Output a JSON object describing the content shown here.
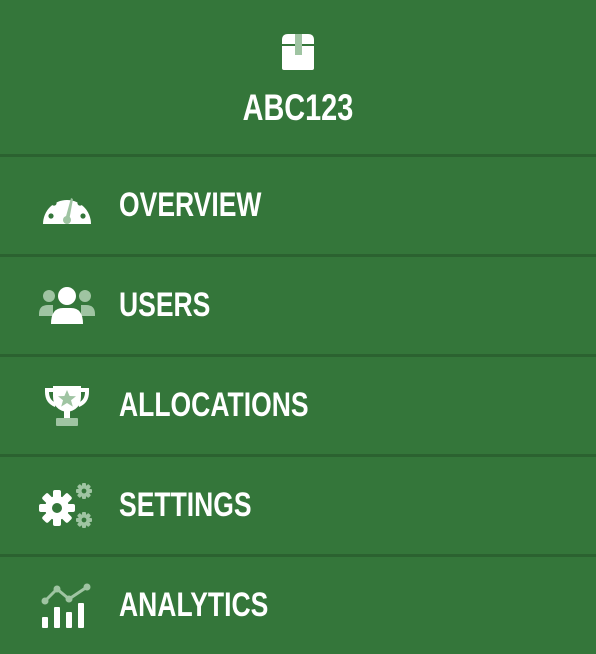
{
  "brand": {
    "title": "ABC123",
    "icon": "box-icon"
  },
  "menu": {
    "items": [
      {
        "label": "OVERVIEW",
        "icon": "gauge-icon"
      },
      {
        "label": "USERS",
        "icon": "users-icon"
      },
      {
        "label": "ALLOCATIONS",
        "icon": "trophy-icon"
      },
      {
        "label": "SETTINGS",
        "icon": "gears-icon"
      },
      {
        "label": "ANALYTICS",
        "icon": "chart-line-icon"
      }
    ]
  },
  "colors": {
    "background": "#34763a",
    "divider": "#2b6230",
    "text": "#ffffff",
    "icon_secondary": "#9fc4a2"
  }
}
